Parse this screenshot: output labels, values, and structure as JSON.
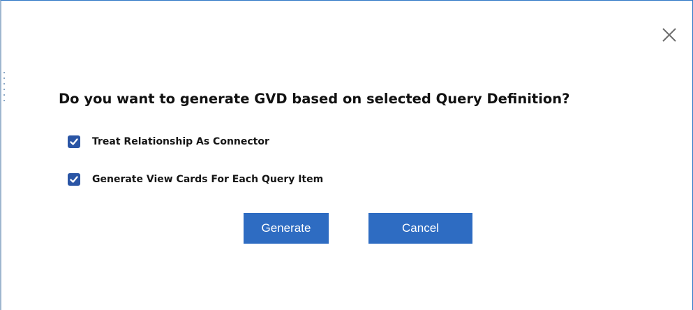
{
  "dialog": {
    "question": "Do you want to generate GVD based on selected Query Definition?",
    "options": [
      {
        "label": "Treat Relationship As Connector",
        "checked": true
      },
      {
        "label": "Generate View Cards For Each Query Item",
        "checked": true
      }
    ],
    "buttons": {
      "generate_label": "Generate",
      "cancel_label": "Cancel"
    },
    "icons": {
      "close": "close-icon",
      "checkbox": "checkmark-icon"
    }
  },
  "colors": {
    "primary_button": "#2e6cc2",
    "checkbox": "#2a55a5",
    "border": "#2f78c6"
  }
}
